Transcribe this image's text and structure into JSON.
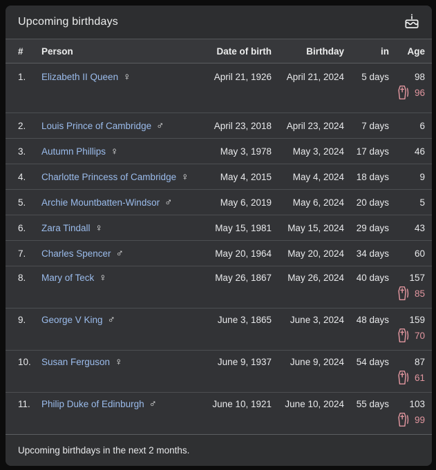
{
  "colors": {
    "link_blue": "#9bbcec",
    "deceased_pink": "#e1969f",
    "card_background": "#313235"
  },
  "header": {
    "title": "Upcoming birthdays",
    "icon": "cake-icon"
  },
  "symbols": {
    "female": "♀",
    "male": "♂"
  },
  "table": {
    "columns": [
      "#",
      "Person",
      "Date of birth",
      "Birthday",
      "in",
      "Age"
    ],
    "rows": [
      {
        "num": "1.",
        "person": "Elizabeth II Queen",
        "gender": "female",
        "dob": "April 21, 1926",
        "birthday": "April 21, 2024",
        "in": "5 days",
        "age": "98",
        "age_at_death": "96"
      },
      {
        "num": "2.",
        "person": "Louis Prince of Cambridge",
        "gender": "male",
        "dob": "April 23, 2018",
        "birthday": "April 23, 2024",
        "in": "7 days",
        "age": "6"
      },
      {
        "num": "3.",
        "person": "Autumn Phillips",
        "gender": "female",
        "dob": "May 3, 1978",
        "birthday": "May 3, 2024",
        "in": "17 days",
        "age": "46"
      },
      {
        "num": "4.",
        "person": "Charlotte Princess of Cambridge",
        "gender": "female",
        "dob": "May 4, 2015",
        "birthday": "May 4, 2024",
        "in": "18 days",
        "age": "9"
      },
      {
        "num": "5.",
        "person": "Archie Mountbatten-Windsor",
        "gender": "male",
        "dob": "May 6, 2019",
        "birthday": "May 6, 2024",
        "in": "20 days",
        "age": "5"
      },
      {
        "num": "6.",
        "person": "Zara Tindall",
        "gender": "female",
        "dob": "May 15, 1981",
        "birthday": "May 15, 2024",
        "in": "29 days",
        "age": "43"
      },
      {
        "num": "7.",
        "person": "Charles Spencer",
        "gender": "male",
        "dob": "May 20, 1964",
        "birthday": "May 20, 2024",
        "in": "34 days",
        "age": "60"
      },
      {
        "num": "8.",
        "person": "Mary of Teck",
        "gender": "female",
        "dob": "May 26, 1867",
        "birthday": "May 26, 2024",
        "in": "40 days",
        "age": "157",
        "age_at_death": "85"
      },
      {
        "num": "9.",
        "person": "George V King",
        "gender": "male",
        "dob": "June 3, 1865",
        "birthday": "June 3, 2024",
        "in": "48 days",
        "age": "159",
        "age_at_death": "70"
      },
      {
        "num": "10.",
        "person": "Susan Ferguson",
        "gender": "female",
        "dob": "June 9, 1937",
        "birthday": "June 9, 2024",
        "in": "54 days",
        "age": "87",
        "age_at_death": "61"
      },
      {
        "num": "11.",
        "person": "Philip Duke of Edinburgh",
        "gender": "male",
        "dob": "June 10, 1921",
        "birthday": "June 10, 2024",
        "in": "55 days",
        "age": "103",
        "age_at_death": "99"
      }
    ]
  },
  "footer": {
    "note": "Upcoming birthdays in the next 2 months."
  }
}
